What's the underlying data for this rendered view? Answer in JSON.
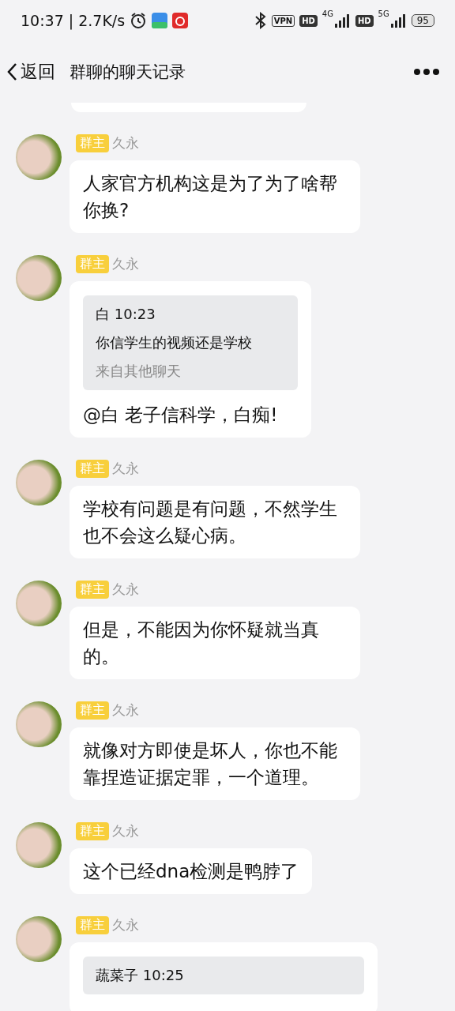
{
  "status_bar": {
    "time": "10:37",
    "separator": "|",
    "speed": "2.7K/s",
    "indicators": [
      "VPN",
      "HD",
      "4G",
      "HD",
      "5G"
    ],
    "battery": "95"
  },
  "header": {
    "back": "返回",
    "title": "群聊的聊天记录"
  },
  "messages": [
    {
      "kind": "text",
      "role": "群主",
      "name": "久永",
      "text": "人家官方机构这是为了为了啥帮你换?"
    },
    {
      "kind": "quote",
      "role": "群主",
      "name": "久永",
      "quote": {
        "sender": "白 10:23",
        "text": "你信学生的视频还是学校",
        "source": "来自其他聊天"
      },
      "text": "@白 老子信科学，白痴!"
    },
    {
      "kind": "text",
      "role": "群主",
      "name": "久永",
      "text": "学校有问题是有问题，不然学生也不会这么疑心病。"
    },
    {
      "kind": "text",
      "role": "群主",
      "name": "久永",
      "text": "但是，不能因为你怀疑就当真的。"
    },
    {
      "kind": "text",
      "role": "群主",
      "name": "久永",
      "text": "就像对方即使是坏人，你也不能靠捏造证据定罪，一个道理。"
    },
    {
      "kind": "text",
      "role": "群主",
      "name": "久永",
      "text": "这个已经dna检测是鸭脖了"
    },
    {
      "kind": "quote",
      "role": "群主",
      "name": "久永",
      "quote": {
        "sender": "蔬菜子 10:25"
      }
    }
  ]
}
